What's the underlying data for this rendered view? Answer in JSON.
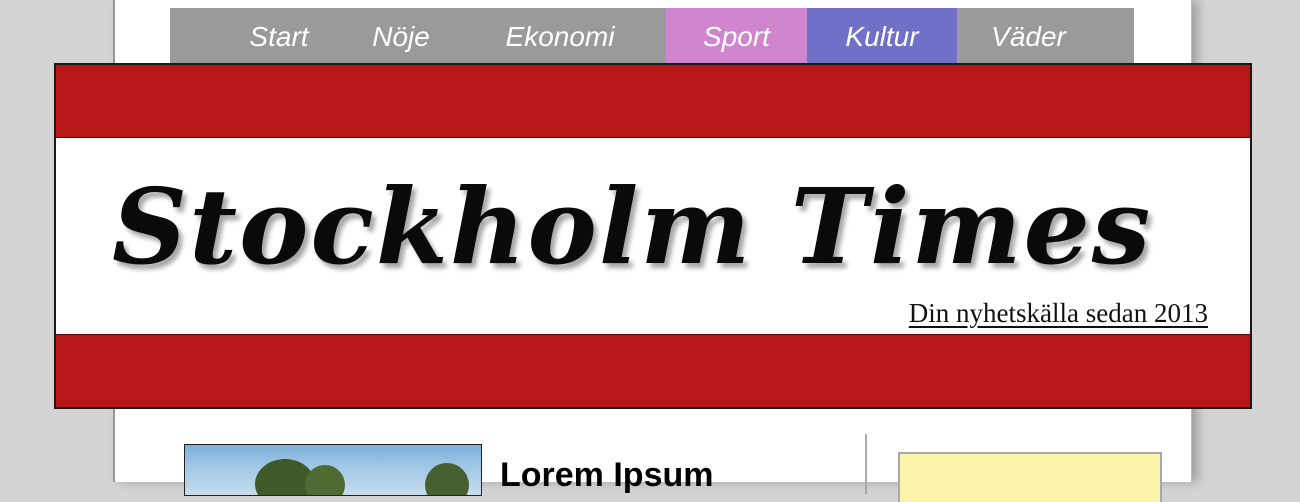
{
  "nav": {
    "items": [
      {
        "label": "Start"
      },
      {
        "label": "Nöje"
      },
      {
        "label": "Ekonomi"
      },
      {
        "label": "Sport"
      },
      {
        "label": "Kultur"
      },
      {
        "label": "Väder"
      }
    ]
  },
  "masthead": {
    "title": "Stockholm Times",
    "tagline": "Din nyhetskälla sedan 2013"
  },
  "article": {
    "title": "Lorem Ipsum"
  },
  "colors": {
    "brand_red": "#b81717",
    "nav_gray": "#9a9a9a",
    "sport_tab": "#cf86cf",
    "kultur_tab": "#7070c8",
    "sidebar_box": "#fbf3a8"
  }
}
